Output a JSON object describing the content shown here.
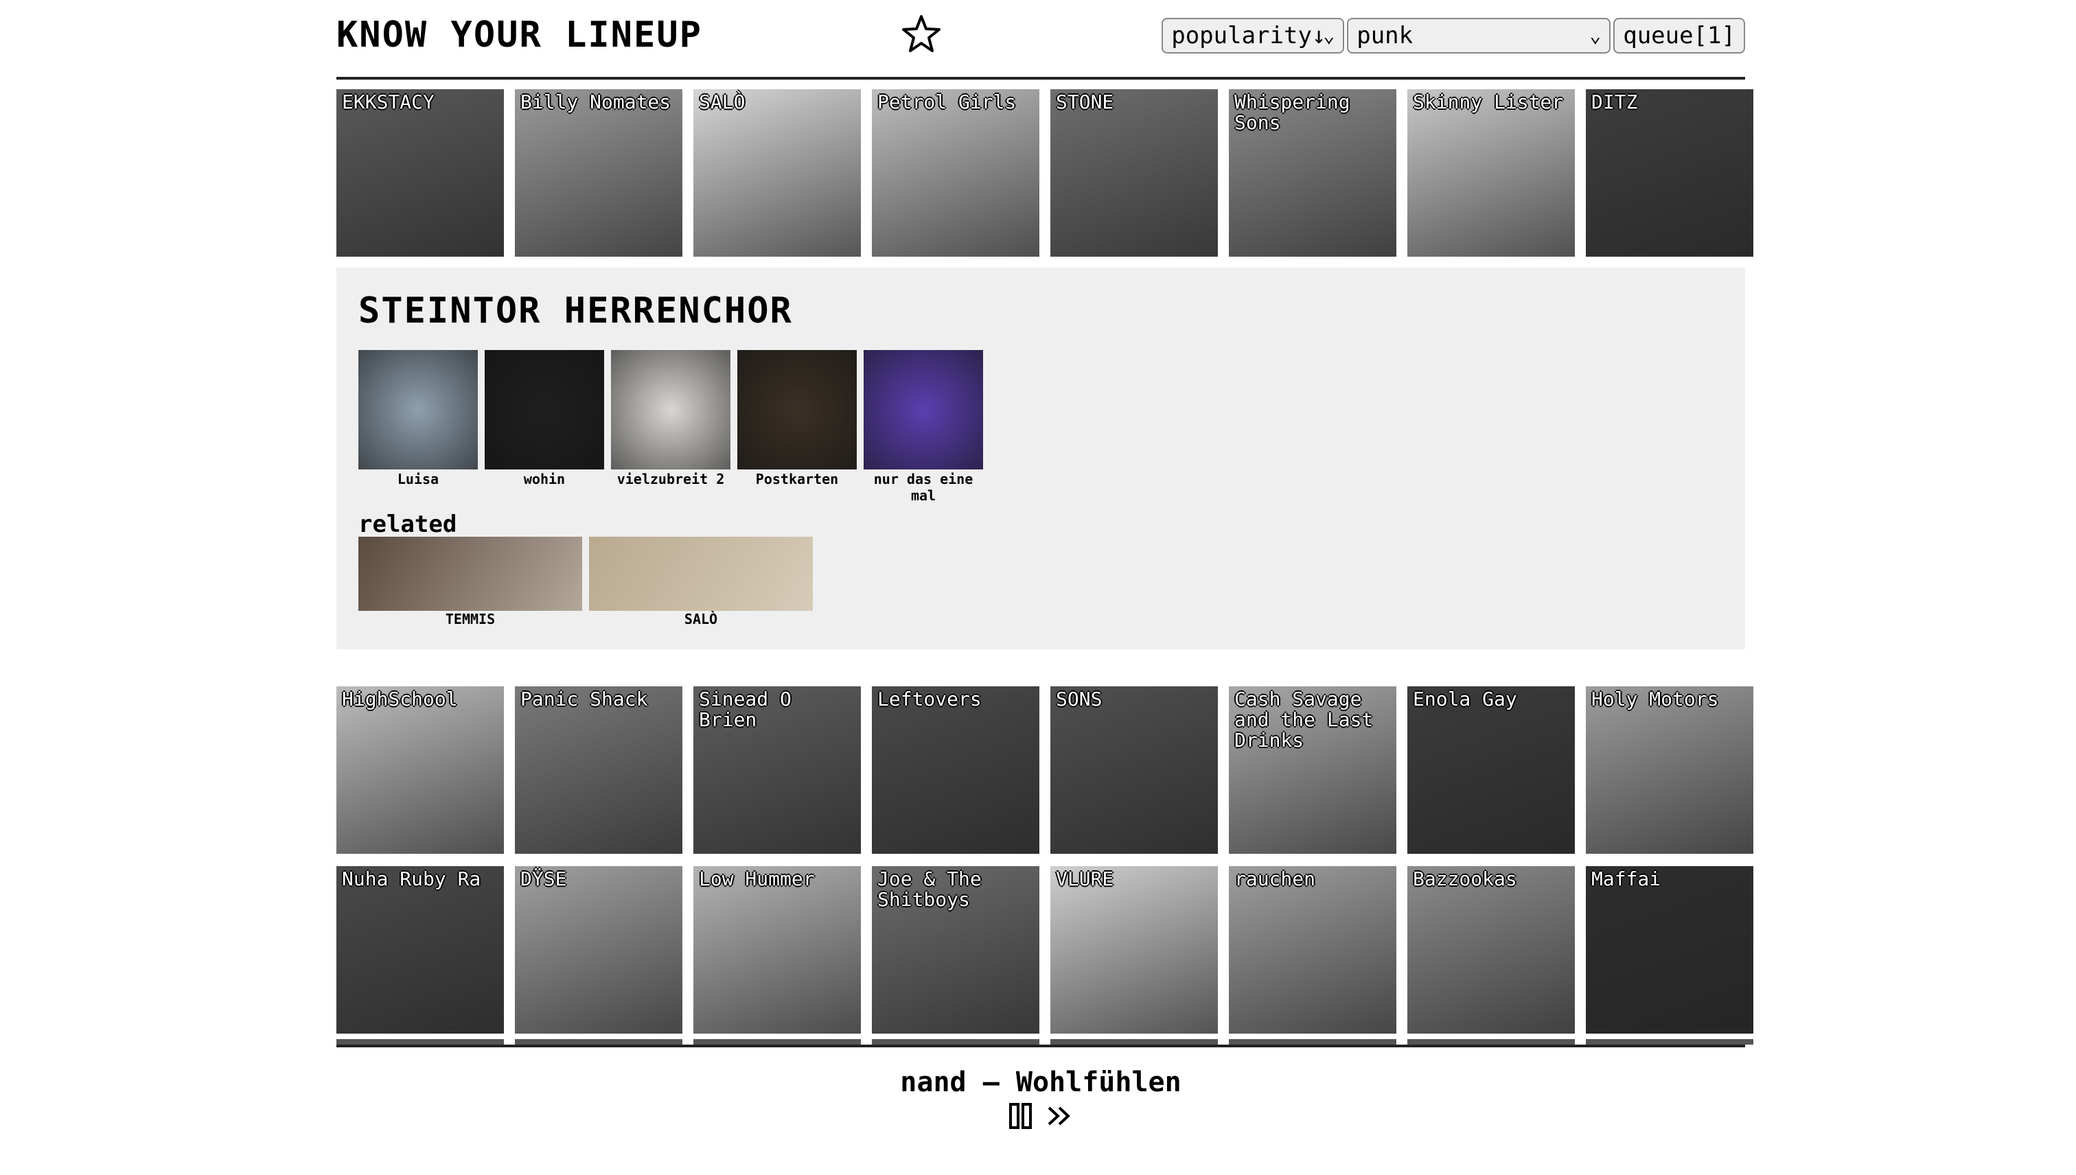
{
  "header": {
    "title": "KNOW YOUR LINEUP",
    "sort_value": "popularity↓",
    "genre_value": "punk",
    "queue_label": "queue[1]"
  },
  "top_row": [
    {
      "name": "EKKSTACY",
      "tone": "#5a5a5a"
    },
    {
      "name": "Billy Nomates",
      "tone": "#9a9a9a"
    },
    {
      "name": "SALÒ",
      "tone": "#d6d6d6"
    },
    {
      "name": "Petrol Girls",
      "tone": "#bdbdbd"
    },
    {
      "name": "STONE",
      "tone": "#6e6e6e"
    },
    {
      "name": "Whispering Sons",
      "tone": "#8a8a8a"
    },
    {
      "name": "Skinny Lister",
      "tone": "#c8c8c8"
    },
    {
      "name": "DITZ",
      "tone": "#3e3e3e"
    }
  ],
  "detail": {
    "artist": "STEINTOR HERRENCHOR",
    "albums": [
      {
        "title": "Luisa",
        "tone": "#8fa0ae"
      },
      {
        "title": "wohin",
        "tone": "#1f1f1f"
      },
      {
        "title": "vielzubreit 2",
        "tone": "#d9d7d2"
      },
      {
        "title": "Postkarten",
        "tone": "#3a3026"
      },
      {
        "title": "nur das eine mal",
        "tone": "#5a3fb0"
      }
    ],
    "related_heading": "related",
    "related": [
      {
        "name": "TEMMIS",
        "tone": "#5b4a3e"
      },
      {
        "name": "SALÒ",
        "tone": "#b9a98f"
      }
    ]
  },
  "grid_row_1": [
    {
      "name": "HighSchool",
      "tone": "#bcbcbc"
    },
    {
      "name": "Panic Shack",
      "tone": "#7a7a7a"
    },
    {
      "name": "Sinead O Brien",
      "tone": "#5e5e5e"
    },
    {
      "name": "Leftovers",
      "tone": "#4a4a4a"
    },
    {
      "name": "SONS",
      "tone": "#505050"
    },
    {
      "name": "Cash Savage and the Last Drinks",
      "tone": "#a8a8a8"
    },
    {
      "name": "Enola Gay",
      "tone": "#3c3c3c"
    },
    {
      "name": "Holy Motors",
      "tone": "#9c9c9c"
    }
  ],
  "grid_row_2": [
    {
      "name": "Nuha Ruby Ra",
      "tone": "#4a4a4a"
    },
    {
      "name": "DŸSE",
      "tone": "#a0a0a0"
    },
    {
      "name": "Low Hummer",
      "tone": "#b4b4b4"
    },
    {
      "name": "Joe & The Shitboys",
      "tone": "#6c6c6c"
    },
    {
      "name": "VLURE",
      "tone": "#cfcfcf"
    },
    {
      "name": "rauchen",
      "tone": "#9e9e9e"
    },
    {
      "name": "Bazzookas",
      "tone": "#8c8c8c"
    },
    {
      "name": "Maffai",
      "tone": "#2e2e2e"
    }
  ],
  "player": {
    "now_playing": "nand – Wohlfühlen"
  },
  "icons": {
    "favorite": "star-outline-icon",
    "pause": "pause-icon",
    "skip": "skip-forward-icon"
  }
}
